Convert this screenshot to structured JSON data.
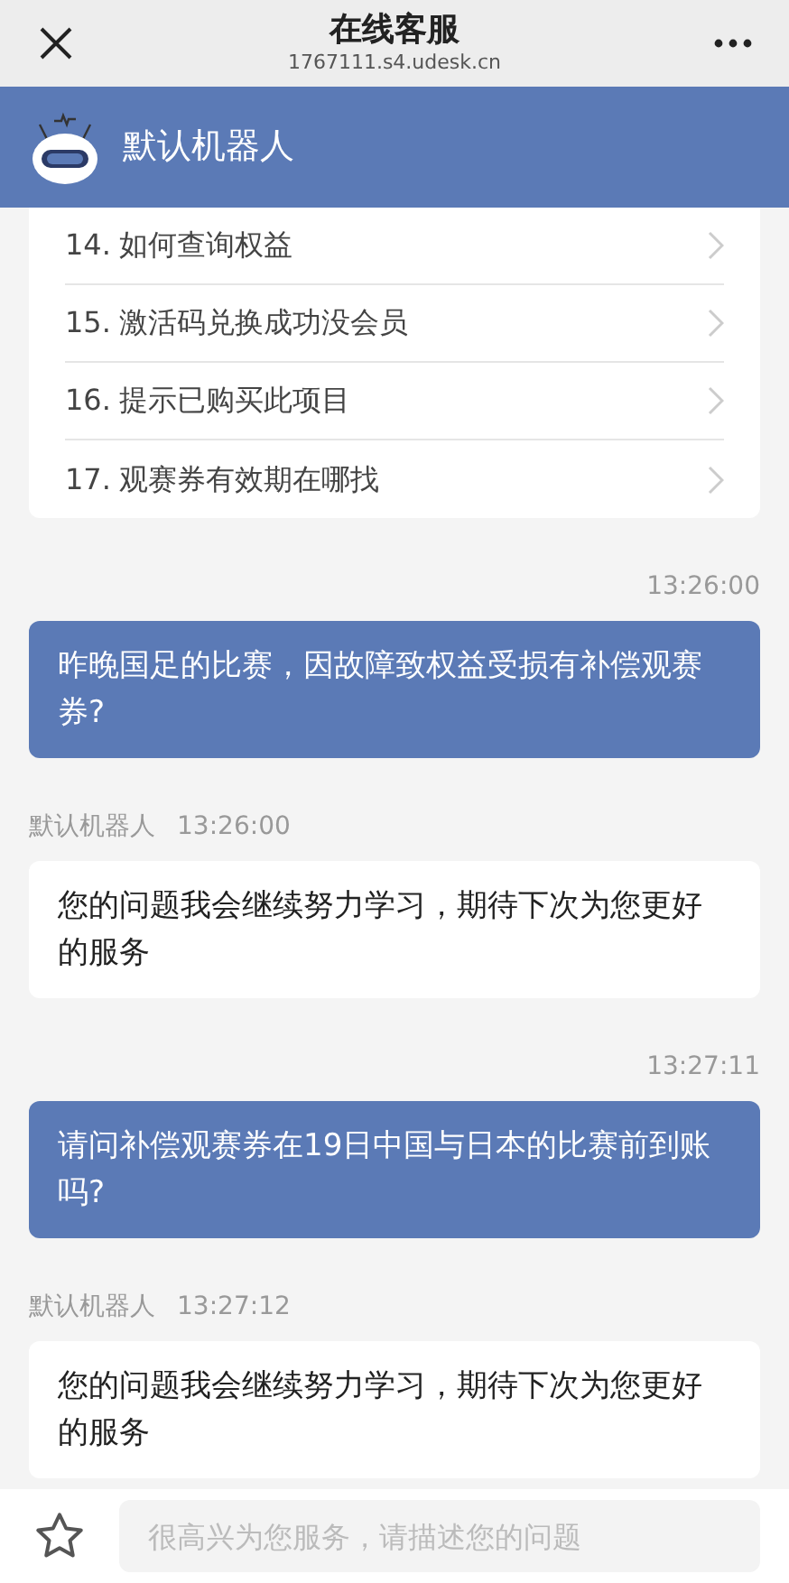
{
  "window": {
    "title": "在线客服",
    "subtitle": "1767111.s4.udesk.cn"
  },
  "header": {
    "name": "默认机器人"
  },
  "faq": [
    {
      "number": "14.",
      "text": "如何查询权益"
    },
    {
      "number": "15.",
      "text": "激活码兑换成功没会员"
    },
    {
      "number": "16.",
      "text": "提示已购买此项目"
    },
    {
      "number": "17.",
      "text": "观赛券有效期在哪找"
    }
  ],
  "messages": [
    {
      "kind": "user",
      "time": "13:26:00",
      "text": "昨晚国足的比赛，因故障致权益受损有补偿观赛券?"
    },
    {
      "kind": "bot",
      "sender": "默认机器人",
      "time": "13:26:00",
      "text": "您的问题我会继续努力学习，期待下次为您更好的服务"
    },
    {
      "kind": "user",
      "time": "13:27:11",
      "text": "请问补偿观赛券在19日中国与日本的比赛前到账吗?"
    },
    {
      "kind": "bot",
      "sender": "默认机器人",
      "time": "13:27:12",
      "text": "您的问题我会继续努力学习，期待下次为您更好的服务"
    }
  ],
  "input": {
    "placeholder": "很高兴为您服务，请描述您的问题"
  }
}
